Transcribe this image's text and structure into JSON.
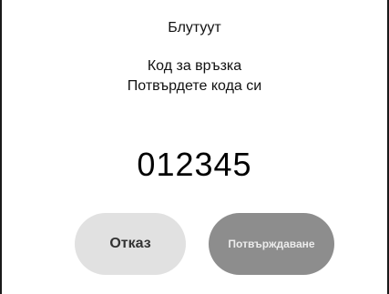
{
  "dialog": {
    "title": "Блутуут",
    "message_line1": "Код за връзка",
    "message_line2": "Потвърдете кода си",
    "code": "012345"
  },
  "buttons": {
    "cancel_label": "Отказ",
    "confirm_label": "Потвърждаване"
  },
  "colors": {
    "background": "#ffffff",
    "cancel_button": "#e1e1e1",
    "confirm_button": "#8d8d8d",
    "text": "#111111"
  }
}
